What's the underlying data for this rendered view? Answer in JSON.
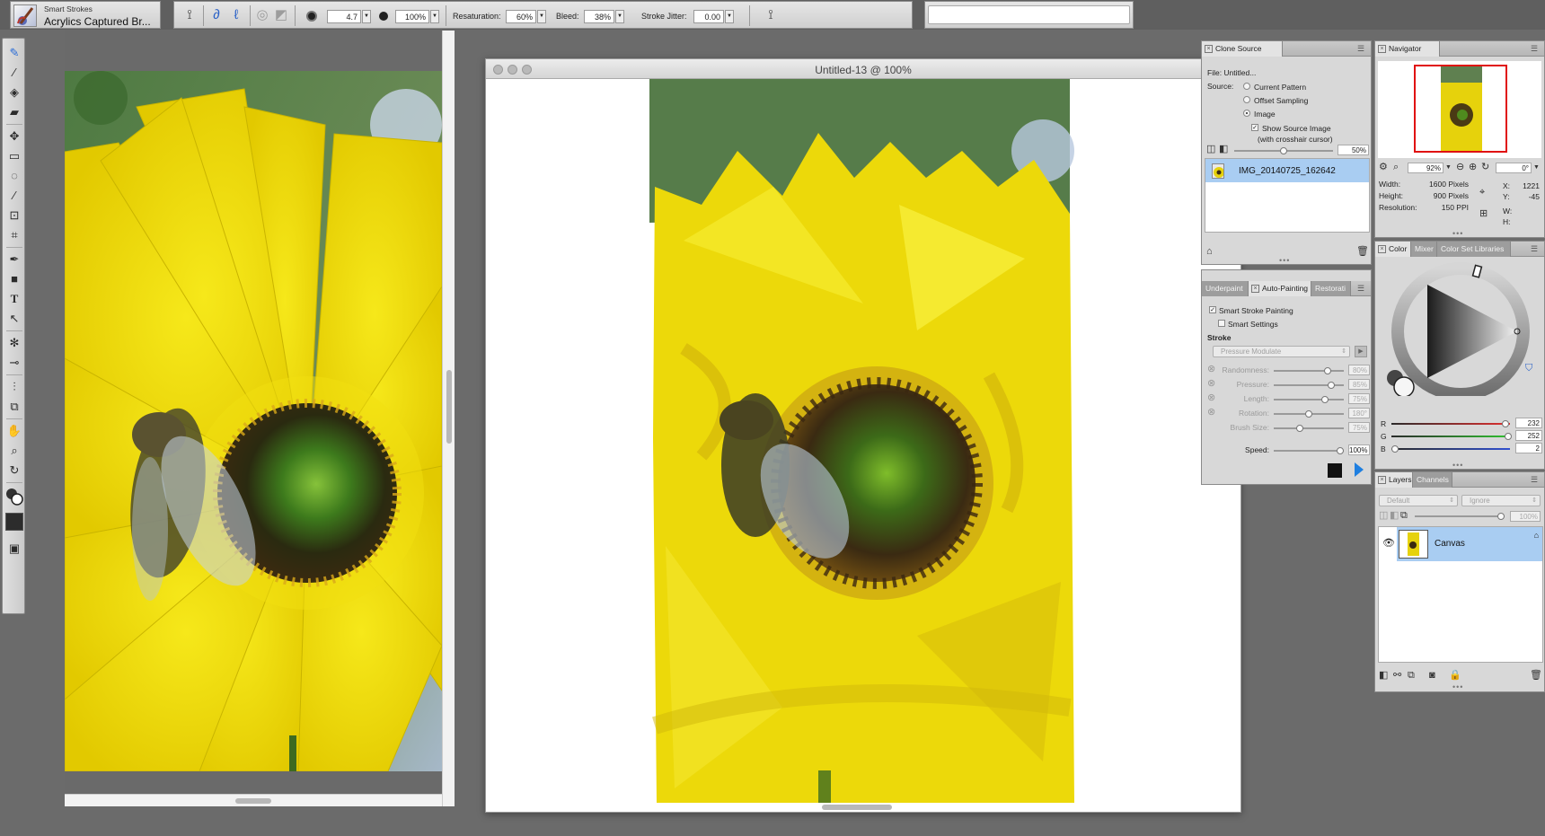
{
  "brush": {
    "category": "Smart Strokes",
    "variant": "Acrylics Captured Br..."
  },
  "property_bar": {
    "size_value": "4.7",
    "opacity_value": "100%",
    "resaturation_label": "Resaturation:",
    "resaturation_value": "60%",
    "bleed_label": "Bleed:",
    "bleed_value": "38%",
    "stroke_jitter_label": "Stroke Jitter:",
    "stroke_jitter_value": "0.00"
  },
  "document": {
    "title": "Untitled-13 @ 100%"
  },
  "clone_source": {
    "tab": "Clone Source",
    "file_label": "File: Untitled...",
    "source_label": "Source:",
    "options": [
      "Current Pattern",
      "Offset Sampling",
      "Image"
    ],
    "selected_option": "Image",
    "show_source_label": "Show Source Image",
    "show_source_sub": "(with crosshair cursor)",
    "show_source_checked": true,
    "opacity_value": "50%",
    "opacity_fraction": 0.5,
    "image_name": "IMG_20140725_162642"
  },
  "auto_painting": {
    "tabs": [
      "Underpaint",
      "Auto-Painting",
      "Restorati"
    ],
    "active_tab": "Auto-Painting",
    "smart_stroke_painting_label": "Smart Stroke Painting",
    "smart_stroke_painting_checked": true,
    "smart_settings_label": "Smart Settings",
    "smart_settings_checked": false,
    "stroke_label": "Stroke",
    "stroke_select_value": "Pressure Modulate",
    "sliders": [
      {
        "label": "Randomness:",
        "value": "80%",
        "fraction": 0.8
      },
      {
        "label": "Pressure:",
        "value": "85%",
        "fraction": 0.85
      },
      {
        "label": "Length:",
        "value": "75%",
        "fraction": 0.75
      },
      {
        "label": "Rotation:",
        "value": "180°",
        "fraction": 0.5
      },
      {
        "label": "Brush Size:",
        "value": "75%",
        "fraction": 0.35
      }
    ],
    "speed_label": "Speed:",
    "speed_value": "100%",
    "speed_fraction": 1.0
  },
  "navigator": {
    "tab": "Navigator",
    "zoom_value": "92%",
    "rotation_value": "0°",
    "width_label": "Width:",
    "width_value": "1600 Pixels",
    "height_label": "Height:",
    "height_value": "900 Pixels",
    "resolution_label": "Resolution:",
    "resolution_value": "150 PPI",
    "x_label": "X:",
    "x_value": "1221",
    "y_label": "Y:",
    "y_value": "-45",
    "w_label": "W:",
    "h_label": "H:"
  },
  "color": {
    "tabs": [
      "Color",
      "Mixer",
      "Color Set Libraries"
    ],
    "active_tab": "Color",
    "r_label": "R",
    "r_value": "232",
    "g_label": "G",
    "g_value": "252",
    "b_label": "B",
    "b_value": "2",
    "current_color": "#e8fc02"
  },
  "layers": {
    "tabs": [
      "Layers",
      "Channels"
    ],
    "active_tab": "Layers",
    "composite_method": "Default",
    "preserve_option": "Ignore",
    "opacity_value": "100%",
    "layer_name": "Canvas"
  },
  "colors": {
    "selection_blue": "#a9cdf2",
    "accent_blue": "#2b62c7",
    "navigator_frame": "#e01010"
  }
}
